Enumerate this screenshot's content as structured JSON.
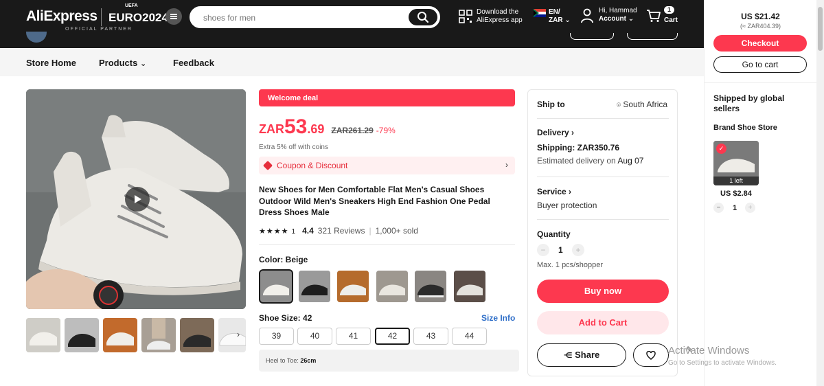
{
  "header": {
    "logo": "AliExpress",
    "euro_logo": "EURO2024",
    "uefa": "UEFA",
    "partner": "OFFICIAL PARTNER",
    "search_placeholder": "shoes for men",
    "app_line1": "Download the",
    "app_line2": "AliExpress app",
    "lang_top": "EN/",
    "lang_bottom": "ZAR",
    "greeting": "Hi, Hammad",
    "account": "Account",
    "cart_label": "Cart",
    "cart_count": "1"
  },
  "store_nav": {
    "home": "Store Home",
    "products": "Products",
    "feedback": "Feedback"
  },
  "product": {
    "welcome": "Welcome deal",
    "currency": "ZAR",
    "price_int": "53",
    "price_dec": ".69",
    "orig_price": "ZAR261.29",
    "discount": "-79%",
    "coins_note": "Extra 5% off with coins",
    "coupon": "Coupon & Discount",
    "title": "New Shoes for Men Comfortable Flat Men's Casual Shoes Outdoor Wild Men's Sneakers High End Fashion One Pedal Dress Shoes Male",
    "stars_text": "★★★★",
    "stars_count": "1",
    "rating": "4.4",
    "reviews": "321 Reviews",
    "sold": "1,000+ sold",
    "color_label": "Color: Beige",
    "size_label": "Shoe Size: 42",
    "size_info": "Size Info",
    "sizes": [
      "39",
      "40",
      "41",
      "42",
      "43",
      "44"
    ],
    "heel_label": "Heel to Toe:",
    "heel_value": "26cm"
  },
  "shipping": {
    "ship_to": "Ship to",
    "country": "South Africa",
    "delivery": "Delivery",
    "shipping_cost": "Shipping: ZAR350.76",
    "estimate_prefix": "Estimated delivery on",
    "estimate_date": "Aug 07",
    "service": "Service",
    "protection": "Buyer protection",
    "quantity": "Quantity",
    "qty_value": "1",
    "max_note": "Max. 1 pcs/shopper",
    "buy_now": "Buy now",
    "add_cart": "Add to Cart",
    "share": "Share"
  },
  "cart_panel": {
    "total": "US $21.42",
    "total_local": "(≈ ZAR404.39)",
    "checkout": "Checkout",
    "go_to_cart": "Go to cart",
    "shipped_by": "Shipped by global sellers",
    "store": "Brand Shoe Store",
    "left": "1 left",
    "item_price": "US $2.84",
    "qty": "1"
  },
  "os": {
    "watermark": "Activate Windows",
    "watermark_sub": "Go to Settings to activate Windows."
  },
  "colors": {
    "accent": "#fd384f",
    "link": "#2e6ec8",
    "dark": "#191919"
  }
}
